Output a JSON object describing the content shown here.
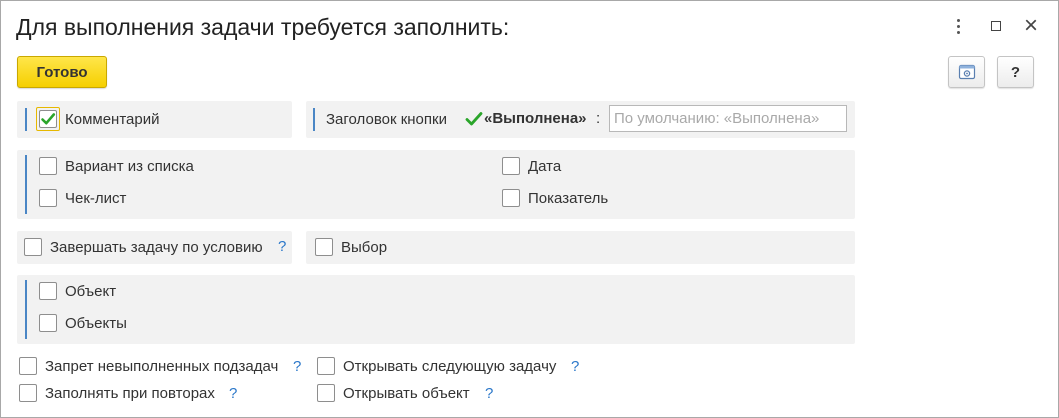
{
  "window": {
    "title": "Для выполнения задачи требуется заполнить:",
    "controls": {
      "more": "more-icon",
      "maximize": "maximize-icon",
      "close": "×"
    }
  },
  "toolbar": {
    "done_label": "Готово",
    "settings_icon": "settings-icon",
    "help_label": "?"
  },
  "comment": {
    "label": "Комментарий",
    "checked": true
  },
  "button_title": {
    "label": "Заголовок кнопки",
    "value": "«Выполнена»",
    "colon": ":",
    "placeholder": "По умолчанию: «Выполнена»"
  },
  "group1": {
    "items": [
      {
        "label": "Вариант из списка",
        "checked": false
      },
      {
        "label": "Чек-лист",
        "checked": false
      },
      {
        "label": "Дата",
        "checked": false
      },
      {
        "label": "Показатель",
        "checked": false
      }
    ]
  },
  "finish_by_condition": {
    "label": "Завершать задачу по условию",
    "help": "?"
  },
  "choice": {
    "label": "Выбор"
  },
  "group2": {
    "items": [
      {
        "label": "Объект",
        "checked": false
      },
      {
        "label": "Объекты",
        "checked": false
      }
    ]
  },
  "bottom": {
    "items": [
      {
        "label": "Запрет невыполненных подзадач",
        "help": "?"
      },
      {
        "label": "Заполнять при повторах",
        "help": "?"
      },
      {
        "label": "Открывать следующую задачу",
        "help": "?"
      },
      {
        "label": "Открывать объект",
        "help": "?"
      }
    ]
  },
  "colors": {
    "accent_bar": "#4a86c5",
    "primary_button": "#f5cf00",
    "check": "#2aa52a",
    "help": "#2a77c9"
  }
}
